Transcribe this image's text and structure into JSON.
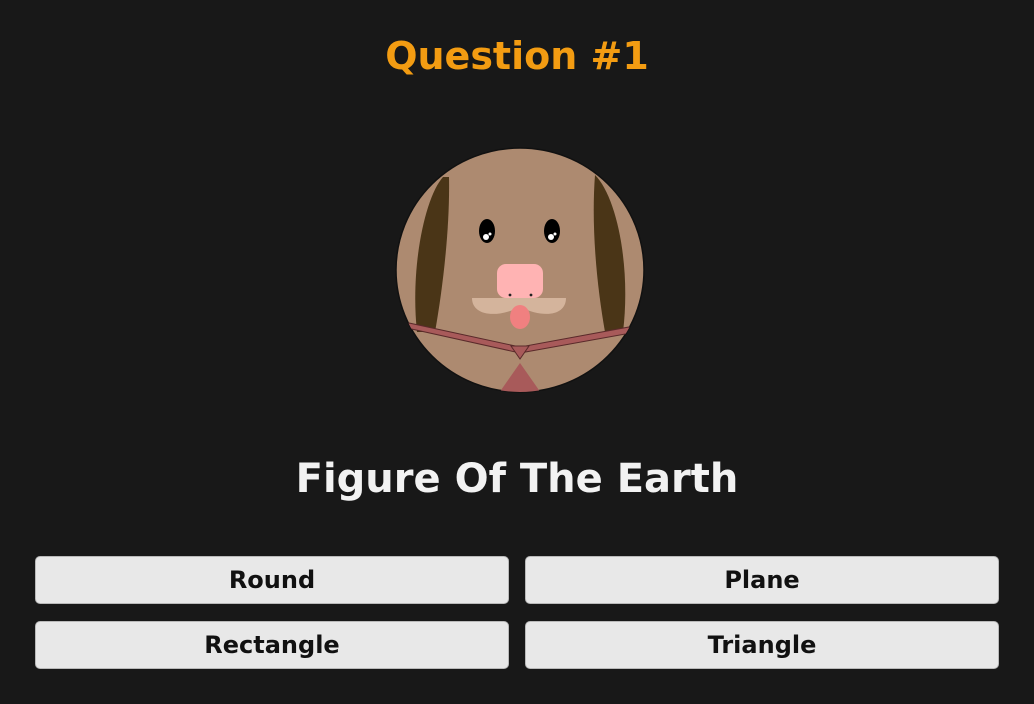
{
  "header": {
    "title": "Question #1"
  },
  "avatar": {
    "icon": "dog-face-icon",
    "colors": {
      "face": "#ad8a70",
      "ears": "#4a3517",
      "nose": "#ffb3b3",
      "muzzle": "#d4b49c",
      "tongue": "#f08080",
      "collar": "#a85a5a"
    }
  },
  "question": {
    "text": "Figure Of The Earth"
  },
  "answers": [
    {
      "label": "Round"
    },
    {
      "label": "Plane"
    },
    {
      "label": "Rectangle"
    },
    {
      "label": "Triangle"
    }
  ],
  "theme": {
    "background": "#181818",
    "accent": "#f39c12",
    "text": "#f2f2f2",
    "button_bg": "#e8e8e8"
  }
}
